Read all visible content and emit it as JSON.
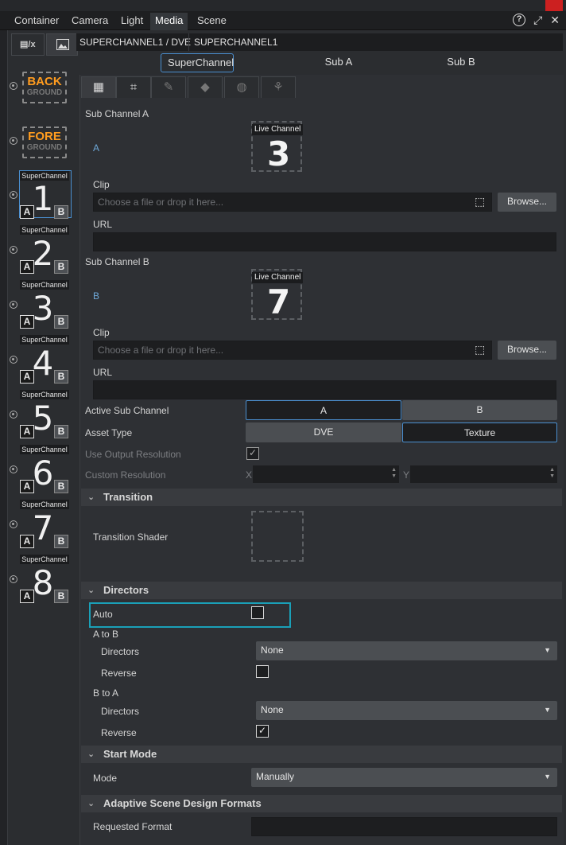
{
  "top_tabs": [
    "Container",
    "Camera",
    "Light",
    "Media",
    "Scene"
  ],
  "path": {
    "left": "SUPERCHANNEL1 / DVE",
    "right": "SUPERCHANNEL1"
  },
  "sc_tabs": [
    "SuperChannel",
    "Sub A",
    "Sub B"
  ],
  "sidebar": {
    "back": {
      "line1": "BACK",
      "line2": "GROUND"
    },
    "fore": {
      "line1": "FORE",
      "line2": "GROUND"
    },
    "channel_label": "SuperChannel",
    "channels": [
      "1",
      "2",
      "3",
      "4",
      "5",
      "6",
      "7",
      "8"
    ],
    "a": "A",
    "b": "B"
  },
  "sub_a": {
    "title": "Sub Channel A",
    "letter": "A",
    "live_label": "Live Channel",
    "live_number": "3",
    "clip_label": "Clip",
    "clip_placeholder": "Choose a file or drop it here...",
    "browse": "Browse...",
    "url_label": "URL"
  },
  "sub_b": {
    "title": "Sub Channel B",
    "letter": "B",
    "live_label": "Live Channel",
    "live_number": "7",
    "clip_label": "Clip",
    "clip_placeholder": "Choose a file or drop it here...",
    "browse": "Browse...",
    "url_label": "URL"
  },
  "active_sub": {
    "label": "Active Sub Channel",
    "options": [
      "A",
      "B"
    ],
    "selected": "A"
  },
  "asset_type": {
    "label": "Asset Type",
    "options": [
      "DVE",
      "Texture"
    ],
    "selected": "Texture"
  },
  "use_output": {
    "label": "Use Output Resolution",
    "checked": true,
    "check_mark": "✓"
  },
  "custom_res": {
    "label": "Custom Resolution",
    "x": "X",
    "y": "Y"
  },
  "transition": {
    "title": "Transition",
    "shader_label": "Transition Shader"
  },
  "directors": {
    "title": "Directors",
    "auto_label": "Auto",
    "a_to_b": "A to B",
    "b_to_a": "B to A",
    "directors_label": "Directors",
    "reverse_label": "Reverse",
    "ab_directors_value": "None",
    "ba_directors_value": "None",
    "ba_reverse_mark": "✓"
  },
  "start_mode": {
    "title": "Start Mode",
    "mode_label": "Mode",
    "mode_value": "Manually"
  },
  "adaptive": {
    "title": "Adaptive Scene Design Formats",
    "requested_label": "Requested Format"
  },
  "colors": {
    "accent": "#4a8fd0",
    "highlight": "#1aa0b8",
    "brand_orange": "#ff9c1f"
  }
}
